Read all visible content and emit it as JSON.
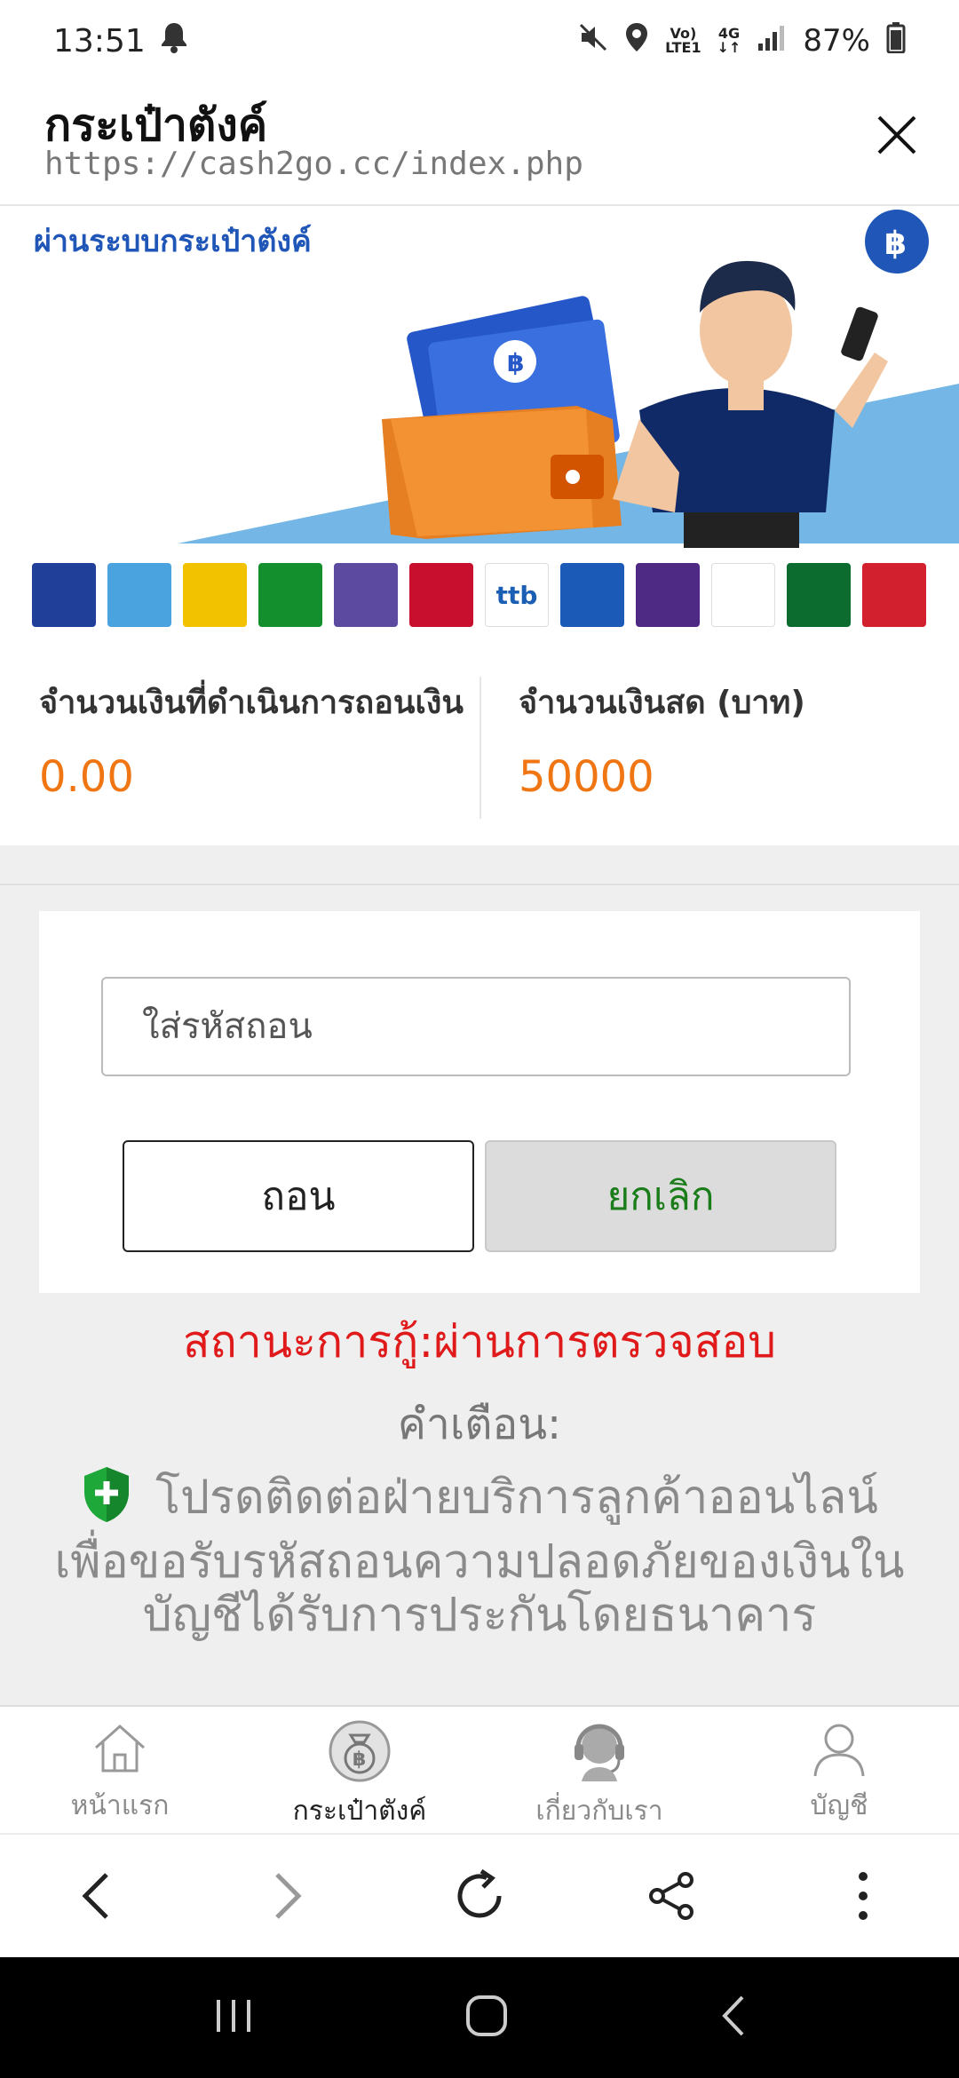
{
  "status_bar": {
    "time": "13:51",
    "volte_top": "Vo)",
    "volte_bottom": "LTE1",
    "network": "4G",
    "battery": "87%"
  },
  "browser": {
    "title": "กระเป๋าตังค์",
    "url": "https://cash2go.cc/index.php"
  },
  "banner": {
    "headline": "ผ่านระบบกระเป๋าตังค์",
    "banks": [
      {
        "text": "",
        "color": "#1f3f98"
      },
      {
        "text": "",
        "color": "#4aa3df"
      },
      {
        "text": "",
        "color": "#f2c200"
      },
      {
        "text": "",
        "color": "#138f2d"
      },
      {
        "text": "",
        "color": "#5b4aa0"
      },
      {
        "text": "",
        "color": "#c8102e"
      },
      {
        "text": "ttb",
        "color": "#ffffff"
      },
      {
        "text": "",
        "color": "#1c5ab8"
      },
      {
        "text": "",
        "color": "#4e2a84"
      },
      {
        "text": "",
        "color": "#ffffff"
      },
      {
        "text": "",
        "color": "#0c6b2f"
      },
      {
        "text": "",
        "color": "#d2202f"
      }
    ]
  },
  "amounts": {
    "processing_label": "จำนวนเงินที่ดำเนินการถอนเงิน",
    "processing_value": "0.00",
    "cash_label": "จำนวนเงินสด (บาท)",
    "cash_value": "50000"
  },
  "form": {
    "code_placeholder": "ใส่รหัสถอน",
    "withdraw_label": "ถอน",
    "cancel_label": "ยกเลิก"
  },
  "loan_status": "สถานะการกู้:ผ่านการตรวจสอบ",
  "warning": {
    "title": "คำเตือน:",
    "line1": "โปรดติดต่อฝ่ายบริการลูกค้าออนไลน์",
    "line2": "เพื่อขอรับรหัสถอนความปลอดภัยของเงินใน",
    "line3": "บัญชีได้รับการประกันโดยธนาคาร"
  },
  "app_nav": {
    "home": "หน้าแรก",
    "wallet": "กระเป๋าตังค์",
    "about": "เกี่ยวกับเรา",
    "account": "บัญชี"
  },
  "colors": {
    "accent_orange": "#f07613",
    "status_red": "#e01a1a",
    "cancel_green": "#1b7d19",
    "banner_blue": "#1f56b8"
  }
}
